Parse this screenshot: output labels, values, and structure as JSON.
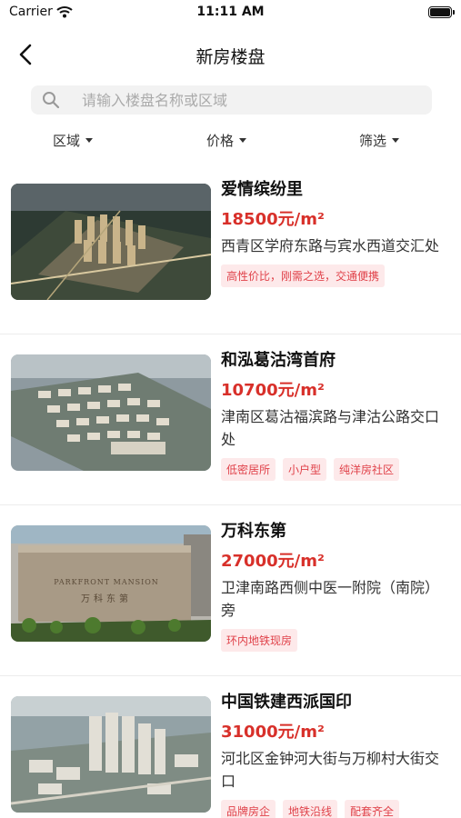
{
  "status_bar": {
    "carrier": "Carrier",
    "time": "11:11 AM"
  },
  "nav": {
    "title": "新房楼盘"
  },
  "search": {
    "placeholder": "请输入楼盘名称或区域"
  },
  "filters": [
    {
      "label": "区域"
    },
    {
      "label": "价格"
    },
    {
      "label": "筛选"
    }
  ],
  "listings": [
    {
      "name": "爱情缤纷里",
      "price": "18500元/m²",
      "address": " 西青区学府东路与宾水西道交汇处",
      "tags": [
        "高性价比，刚需之选，交通便携"
      ]
    },
    {
      "name": "和泓葛沽湾首府",
      "price": "10700元/m²",
      "address": "津南区葛沽福滨路与津沽公路交口处",
      "tags": [
        "低密居所",
        "小户型",
        "纯洋房社区"
      ]
    },
    {
      "name": "万科东第",
      "price": "27000元/m²",
      "address": "卫津南路西侧中医一附院（南院）旁",
      "tags": [
        "环内地铁现房"
      ],
      "sign_text": "PARKFRONT MANSION"
    },
    {
      "name": "中国铁建西派国印",
      "price": "31000元/m²",
      "address": "河北区金钟河大街与万柳村大街交口",
      "tags": [
        "品牌房企",
        "地铁沿线",
        "配套齐全"
      ]
    }
  ],
  "colors": {
    "accent": "#d8302a",
    "tag_bg": "#fde9ea",
    "tag_text": "#e0424a"
  }
}
